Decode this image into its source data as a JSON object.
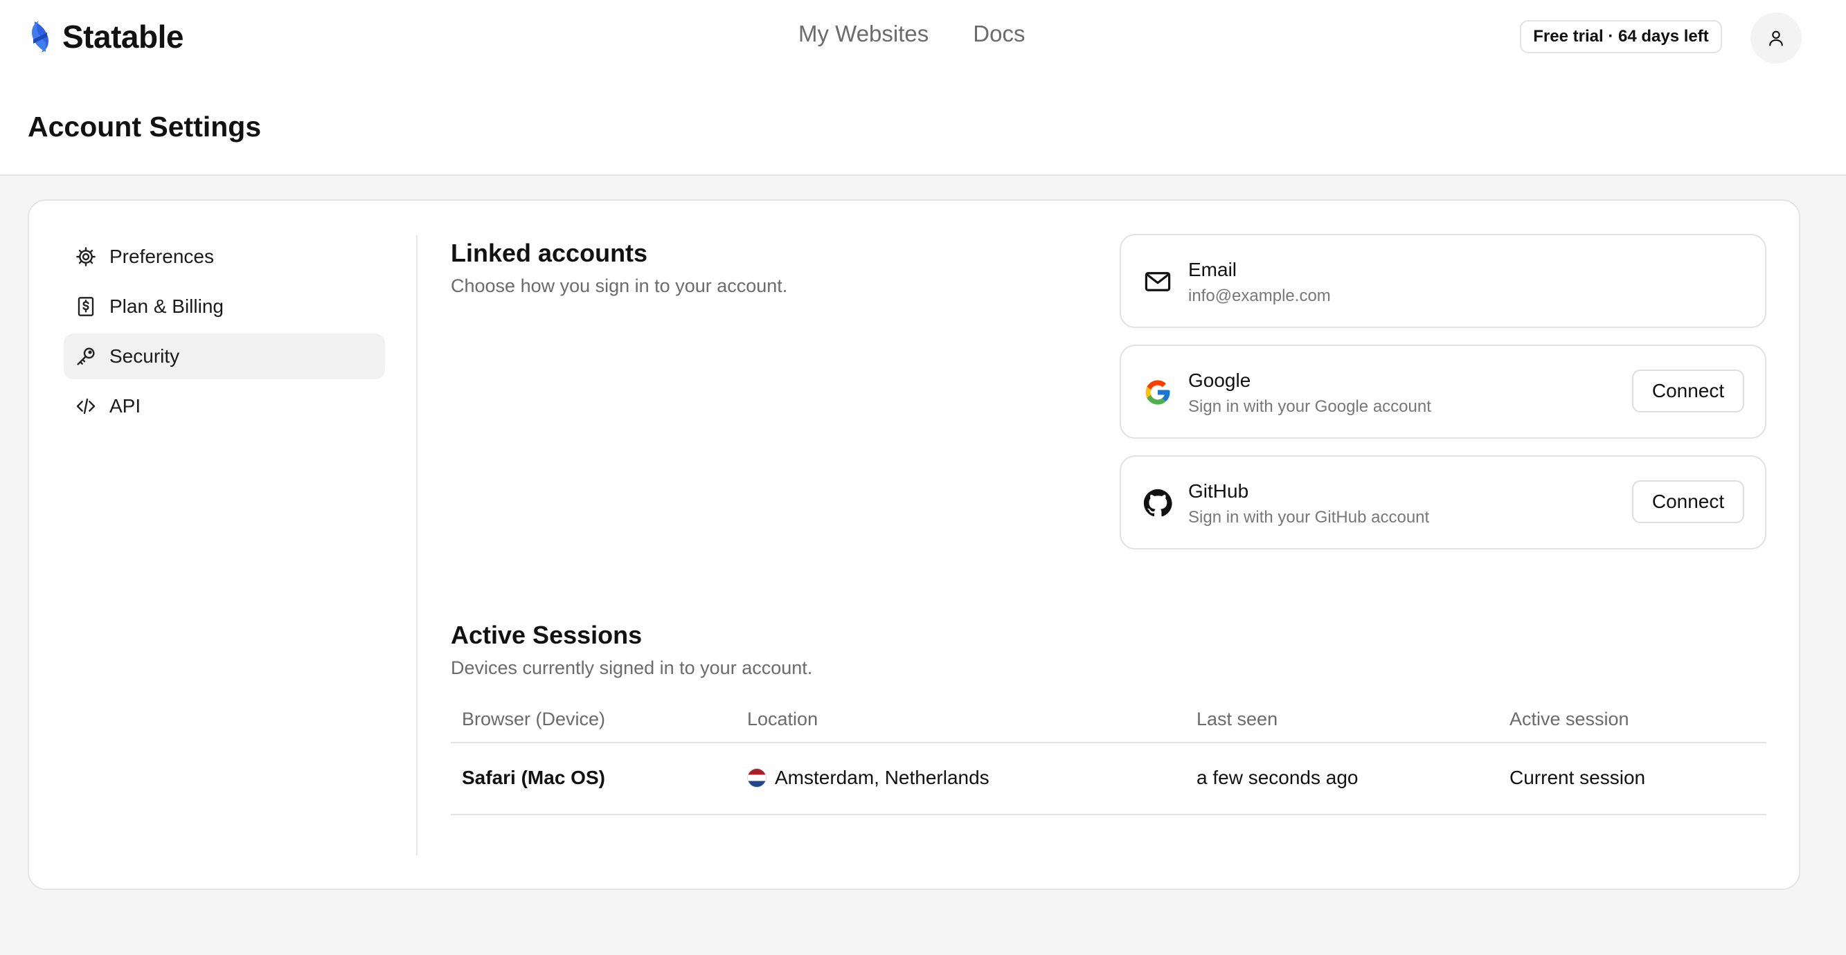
{
  "app": {
    "name": "Statable"
  },
  "nav": {
    "items": [
      "My Websites",
      "Docs"
    ]
  },
  "trial_badge": "Free trial · 64 days left",
  "page_title": "Account Settings",
  "sidebar": {
    "items": [
      {
        "label": "Preferences",
        "icon": "gear-icon"
      },
      {
        "label": "Plan & Billing",
        "icon": "billing-icon"
      },
      {
        "label": "Security",
        "icon": "key-icon",
        "active": true
      },
      {
        "label": "API",
        "icon": "code-icon"
      }
    ]
  },
  "linked_accounts": {
    "title": "Linked accounts",
    "subtitle": "Choose how you sign in to your account.",
    "accounts": [
      {
        "name": "Email",
        "description": "info@example.com",
        "icon": "mail-icon"
      },
      {
        "name": "Google",
        "description": "Sign in with your Google account",
        "icon": "google-icon",
        "action": "Connect"
      },
      {
        "name": "GitHub",
        "description": "Sign in with your GitHub account",
        "icon": "github-icon",
        "action": "Connect"
      }
    ]
  },
  "sessions": {
    "title": "Active Sessions",
    "subtitle": "Devices currently signed in to your account.",
    "columns": [
      "Browser (Device)",
      "Location",
      "Last seen",
      "Active session"
    ],
    "rows": [
      {
        "browser": "Safari (Mac OS)",
        "location": "Amsterdam, Netherlands",
        "last_seen": "a few seconds ago",
        "status": "Current session",
        "flag": "netherlands-flag"
      }
    ]
  },
  "colors": {
    "brand": "#2f62e0",
    "active_bg": "#f1f1f1",
    "page_bg": "#f5f5f5"
  }
}
